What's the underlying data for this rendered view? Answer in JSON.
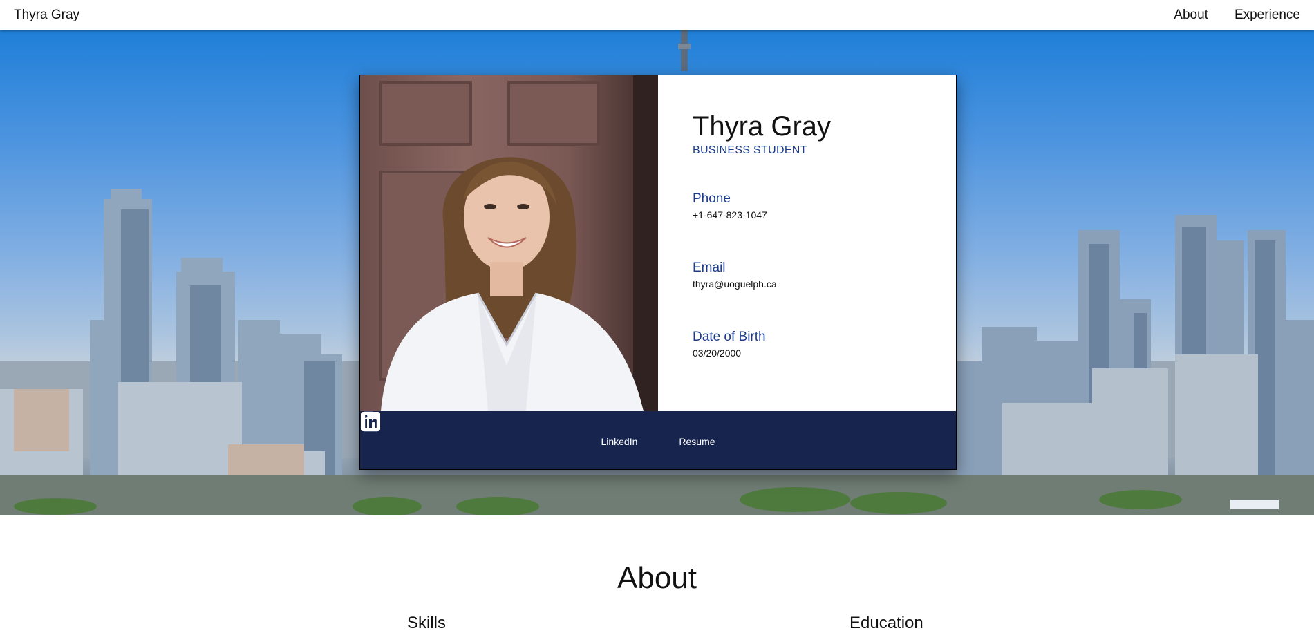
{
  "nav": {
    "brand": "Thyra Gray",
    "links": [
      "About",
      "Experience"
    ]
  },
  "profile": {
    "name": "Thyra Gray",
    "role": "BUSINESS STUDENT",
    "fields": [
      {
        "label": "Phone",
        "value": "+1-647-823-1047"
      },
      {
        "label": "Email",
        "value": "thyra@uoguelph.ca"
      },
      {
        "label": "Date of Birth",
        "value": "03/20/2000"
      }
    ]
  },
  "footer_links": [
    {
      "label": "LinkedIn",
      "icon": "linkedin-icon"
    },
    {
      "label": "Resume",
      "icon": "document-icon"
    }
  ],
  "about": {
    "title": "About",
    "columns": [
      "Skills",
      "Education"
    ]
  },
  "colors": {
    "accent_blue": "#1a3a8a",
    "footer_navy": "#17244e"
  }
}
